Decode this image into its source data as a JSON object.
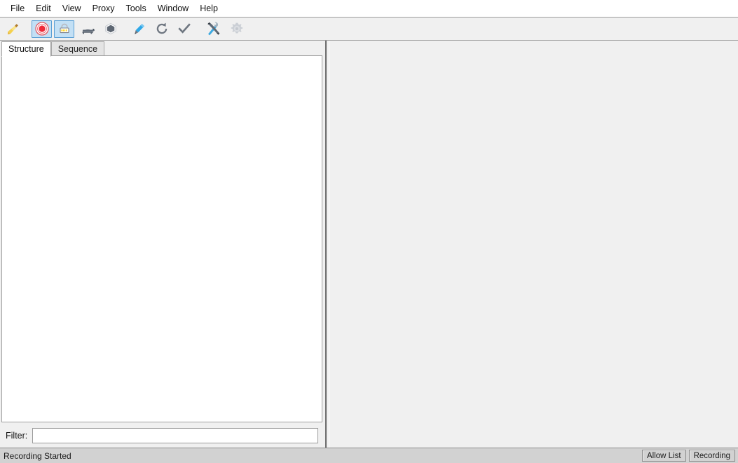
{
  "menubar": {
    "items": [
      {
        "label": "File"
      },
      {
        "label": "Edit"
      },
      {
        "label": "View"
      },
      {
        "label": "Proxy"
      },
      {
        "label": "Tools"
      },
      {
        "label": "Window"
      },
      {
        "label": "Help"
      }
    ]
  },
  "toolbar": {
    "buttons": [
      {
        "icon": "broom-icon",
        "name": "clear-session-button",
        "selected": false
      },
      {
        "icon": "record-icon",
        "name": "start-recording-button",
        "selected": true
      },
      {
        "icon": "ssl-lock-icon",
        "name": "ssl-proxying-button",
        "selected": true
      },
      {
        "icon": "turtle-icon",
        "name": "throttle-button",
        "selected": false
      },
      {
        "icon": "hexagon-icon",
        "name": "breakpoints-button",
        "selected": false
      },
      {
        "icon": "pen-icon",
        "name": "compose-button",
        "selected": false
      },
      {
        "icon": "repeat-icon",
        "name": "repeat-button",
        "selected": false
      },
      {
        "icon": "checkmark-icon",
        "name": "validate-button",
        "selected": false
      },
      {
        "icon": "tools-icon",
        "name": "tools-button",
        "selected": false
      },
      {
        "icon": "gear-icon",
        "name": "settings-button",
        "selected": false
      }
    ]
  },
  "tabs": [
    {
      "label": "Structure",
      "active": true
    },
    {
      "label": "Sequence",
      "active": false
    }
  ],
  "tree": {
    "items": []
  },
  "filter": {
    "label": "Filter:",
    "value": "",
    "placeholder": ""
  },
  "statusbar": {
    "message": "Recording Started",
    "buttons": [
      {
        "label": "Allow List"
      },
      {
        "label": "Recording"
      }
    ]
  },
  "colors": {
    "window_bg": "#f0f0f0",
    "menubar_bg": "#ffffff",
    "content_bg": "#ffffff",
    "statusbar_bg": "#d2d2d2",
    "selected_button_bg": "#c3e0f5",
    "selected_button_border": "#5a9fd4",
    "record_red": "#ee2b3a",
    "broom_yellow": "#f0c33c",
    "pen_blue": "#2fa8e8"
  }
}
